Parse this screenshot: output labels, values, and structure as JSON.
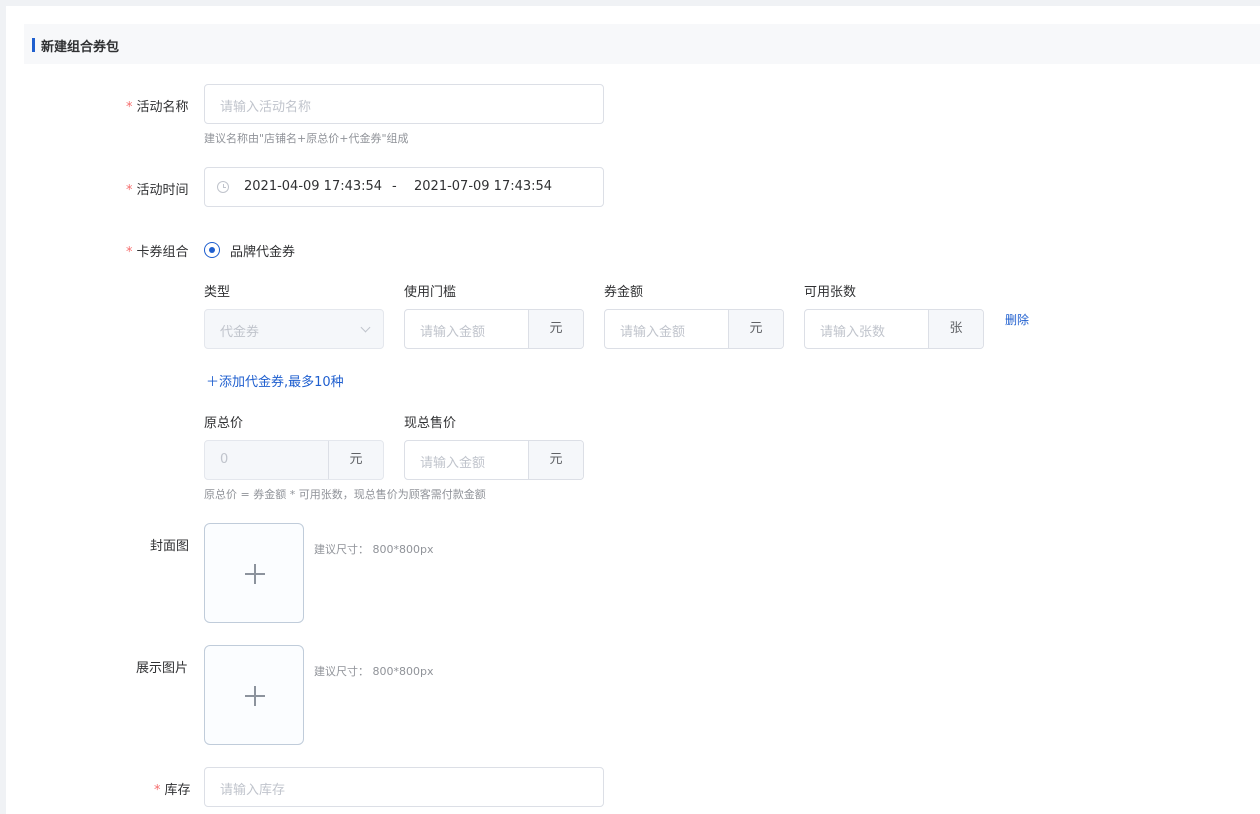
{
  "section": {
    "title": "新建组合券包"
  },
  "fields": {
    "name": {
      "label": "活动名称",
      "placeholder": "请输入活动名称",
      "hint": "建议名称由\"店铺名+原总价+代金券\"组成"
    },
    "time": {
      "label": "活动时间",
      "start": "2021-04-09 17:43:54",
      "separator": "-",
      "end": "2021-07-09 17:43:54"
    },
    "combo": {
      "label": "卡券组合",
      "radio_label": "品牌代金券",
      "columns": [
        "类型",
        "使用门槛",
        "券金额",
        "可用张数"
      ],
      "row": {
        "type_value": "代金券",
        "threshold_placeholder": "请输入金额",
        "threshold_unit": "元",
        "amount_placeholder": "请输入金额",
        "amount_unit": "元",
        "count_placeholder": "请输入张数",
        "count_unit": "张",
        "delete_label": "删除"
      },
      "add_label": "＋添加代金券,最多10种"
    },
    "price": {
      "original_label": "原总价",
      "original_value": "0",
      "original_unit": "元",
      "current_label": "现总售价",
      "current_placeholder": "请输入金额",
      "current_unit": "元",
      "hint": "原总价 = 券金额 * 可用张数，现总售价为顾客需付款金额"
    },
    "cover": {
      "label": "封面图",
      "hint": "建议尺寸：  800*800px"
    },
    "display": {
      "label": "展示图片",
      "hint": "建议尺寸：  800*800px"
    },
    "stock": {
      "label": "库存",
      "placeholder": "请输入库存"
    }
  },
  "colors": {
    "accent": "#1f5fcf",
    "required": "#f56c6c"
  }
}
